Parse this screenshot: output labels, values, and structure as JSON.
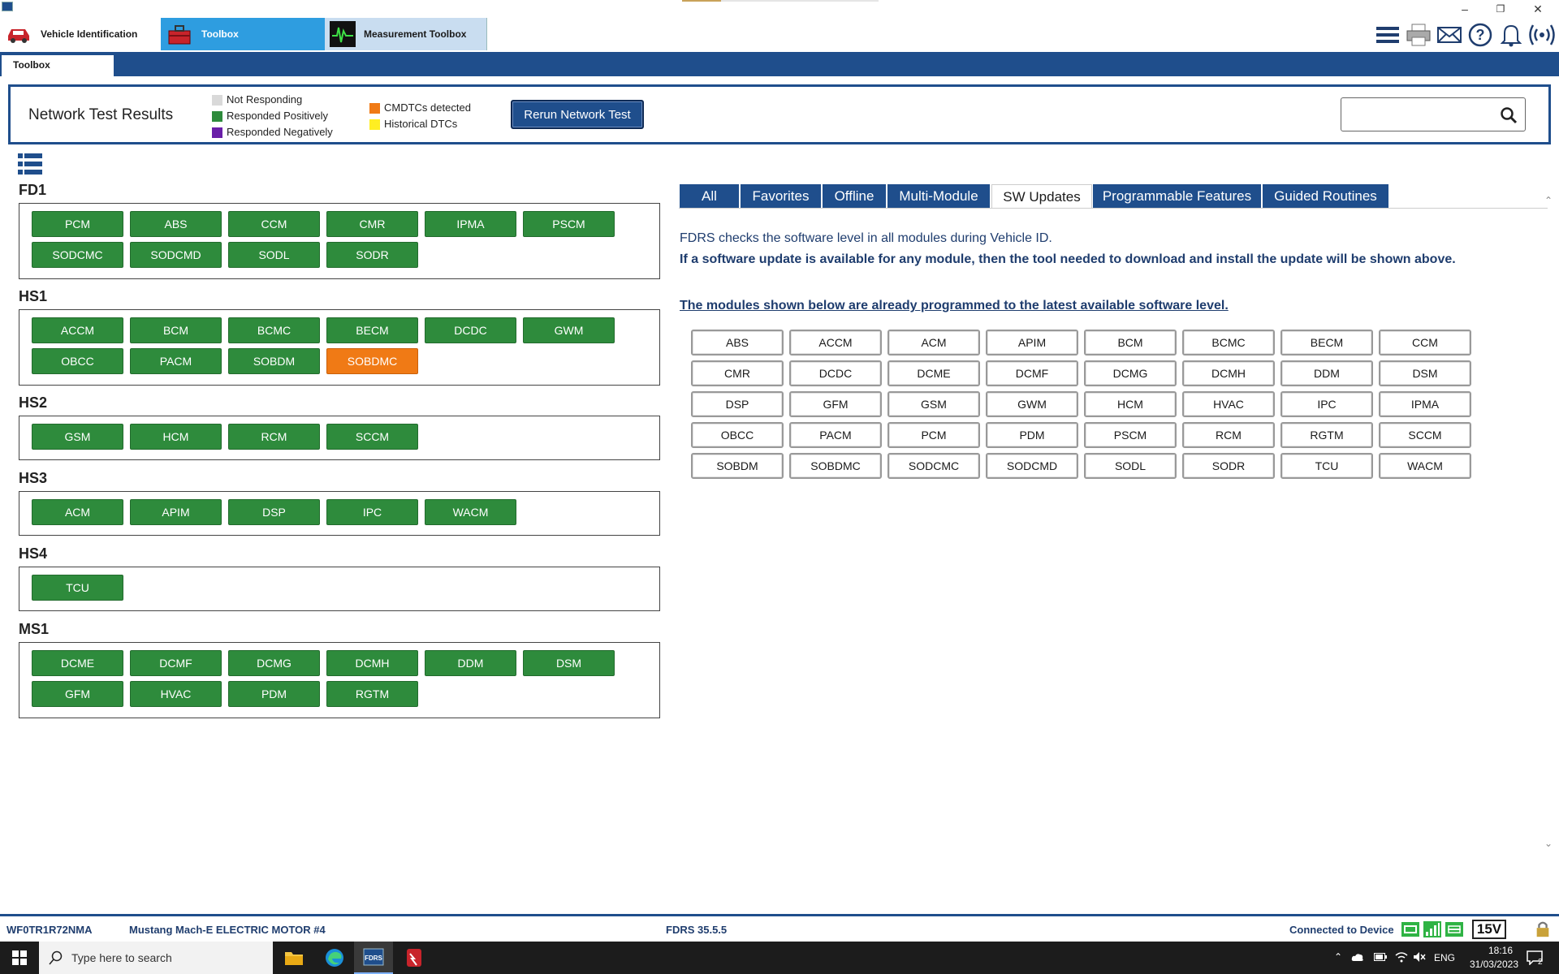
{
  "top_nav": {
    "tabs": [
      {
        "label": "Vehicle Identification",
        "icon": "car-icon"
      },
      {
        "label": "Toolbox",
        "icon": "toolbox-icon"
      },
      {
        "label": "Measurement Toolbox",
        "icon": "oscilloscope-icon"
      }
    ],
    "right_icons": [
      "menu-icon",
      "printer-icon",
      "mail-icon",
      "help-icon",
      "bell-icon",
      "wireless-icon"
    ]
  },
  "sub_tab": {
    "label": "Toolbox"
  },
  "network_test": {
    "title": "Network Test Results",
    "legend": [
      {
        "label": "Not Responding",
        "color": "#d9d9d9"
      },
      {
        "label": "Responded Positively",
        "color": "#2e8b3c"
      },
      {
        "label": "Responded Negatively",
        "color": "#6a1fa8"
      },
      {
        "label": "CMDTCs detected",
        "color": "#f07a15"
      },
      {
        "label": "Historical DTCs",
        "color": "#ffee22"
      }
    ],
    "rerun_label": "Rerun Network Test",
    "search_value": ""
  },
  "buses": [
    {
      "name": "FD1",
      "modules": [
        {
          "label": "PCM",
          "status": "positive"
        },
        {
          "label": "ABS",
          "status": "positive"
        },
        {
          "label": "CCM",
          "status": "positive"
        },
        {
          "label": "CMR",
          "status": "positive"
        },
        {
          "label": "IPMA",
          "status": "positive"
        },
        {
          "label": "PSCM",
          "status": "positive"
        },
        {
          "label": "SODCMC",
          "status": "positive"
        },
        {
          "label": "SODCMD",
          "status": "positive"
        },
        {
          "label": "SODL",
          "status": "positive"
        },
        {
          "label": "SODR",
          "status": "positive"
        }
      ]
    },
    {
      "name": "HS1",
      "modules": [
        {
          "label": "ACCM",
          "status": "positive"
        },
        {
          "label": "BCM",
          "status": "positive"
        },
        {
          "label": "BCMC",
          "status": "positive"
        },
        {
          "label": "BECM",
          "status": "positive"
        },
        {
          "label": "DCDC",
          "status": "positive"
        },
        {
          "label": "GWM",
          "status": "positive"
        },
        {
          "label": "OBCC",
          "status": "positive"
        },
        {
          "label": "PACM",
          "status": "positive"
        },
        {
          "label": "SOBDM",
          "status": "positive"
        },
        {
          "label": "SOBDMC",
          "status": "cmdtc"
        }
      ]
    },
    {
      "name": "HS2",
      "modules": [
        {
          "label": "GSM",
          "status": "positive"
        },
        {
          "label": "HCM",
          "status": "positive"
        },
        {
          "label": "RCM",
          "status": "positive"
        },
        {
          "label": "SCCM",
          "status": "positive"
        }
      ]
    },
    {
      "name": "HS3",
      "modules": [
        {
          "label": "ACM",
          "status": "positive"
        },
        {
          "label": "APIM",
          "status": "positive"
        },
        {
          "label": "DSP",
          "status": "positive"
        },
        {
          "label": "IPC",
          "status": "positive"
        },
        {
          "label": "WACM",
          "status": "positive"
        }
      ]
    },
    {
      "name": "HS4",
      "modules": [
        {
          "label": "TCU",
          "status": "positive"
        }
      ]
    },
    {
      "name": "MS1",
      "modules": [
        {
          "label": "DCME",
          "status": "positive"
        },
        {
          "label": "DCMF",
          "status": "positive"
        },
        {
          "label": "DCMG",
          "status": "positive"
        },
        {
          "label": "DCMH",
          "status": "positive"
        },
        {
          "label": "DDM",
          "status": "positive"
        },
        {
          "label": "DSM",
          "status": "positive"
        },
        {
          "label": "GFM",
          "status": "positive"
        },
        {
          "label": "HVAC",
          "status": "positive"
        },
        {
          "label": "PDM",
          "status": "positive"
        },
        {
          "label": "RGTM",
          "status": "positive"
        }
      ]
    }
  ],
  "right_tabs": [
    {
      "label": "All",
      "active": false
    },
    {
      "label": "Favorites",
      "active": false
    },
    {
      "label": "Offline",
      "active": false
    },
    {
      "label": "Multi-Module",
      "active": false
    },
    {
      "label": "SW Updates",
      "active": true
    },
    {
      "label": "Programmable Features",
      "active": false
    },
    {
      "label": "Guided Routines",
      "active": false
    }
  ],
  "sw_updates": {
    "info_line1": "FDRS checks the software level in all modules during Vehicle ID.",
    "info_line2": "If a software update is available for any module, then the tool needed to download and install the update will be shown above.",
    "latest_heading": "The modules shown below are already programmed to the latest available software level.",
    "modules": [
      "ABS",
      "ACCM",
      "ACM",
      "APIM",
      "BCM",
      "BCMC",
      "BECM",
      "CCM",
      "CMR",
      "DCDC",
      "DCME",
      "DCMF",
      "DCMG",
      "DCMH",
      "DDM",
      "DSM",
      "DSP",
      "GFM",
      "GSM",
      "GWM",
      "HCM",
      "HVAC",
      "IPC",
      "IPMA",
      "OBCC",
      "PACM",
      "PCM",
      "PDM",
      "PSCM",
      "RCM",
      "RGTM",
      "SCCM",
      "SOBDM",
      "SOBDMC",
      "SODCMC",
      "SODCMD",
      "SODL",
      "SODR",
      "TCU",
      "WACM"
    ]
  },
  "status_bar": {
    "vin": "WF0TR1R72NMA",
    "vehicle": "Mustang Mach-E ELECTRIC MOTOR #4",
    "version": "FDRS 35.5.5",
    "connection": "Connected to Device",
    "voltage": "15V"
  },
  "taskbar": {
    "search_placeholder": "Type here to search",
    "language": "ENG",
    "time": "18:16",
    "date": "31/03/2023",
    "notifications": "2"
  },
  "colors": {
    "brand_blue": "#1f4e8c",
    "positive": "#2e8b3c",
    "cmdtc": "#f07a15"
  }
}
